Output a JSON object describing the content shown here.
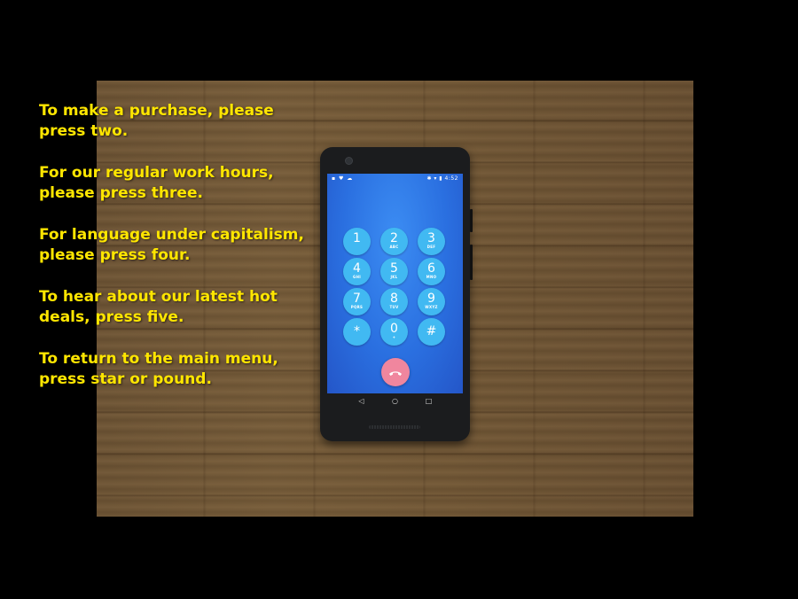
{
  "menu": {
    "lines": [
      "To make a purchase, please",
      "press two.",
      "For our regular work hours,",
      "please press three.",
      "For language under capitalism,",
      "please press four.",
      "To hear about our latest hot",
      "deals, press five.",
      "To return to the main menu,",
      "press star or pound."
    ],
    "text_color": "#ffe600"
  },
  "phone": {
    "status_left": "▪ ♥ ☁",
    "status_right": "✱ ▾ ▮ 4:52",
    "keypad": [
      {
        "digit": "1",
        "letters": ""
      },
      {
        "digit": "2",
        "letters": "ABC"
      },
      {
        "digit": "3",
        "letters": "DEF"
      },
      {
        "digit": "4",
        "letters": "GHI"
      },
      {
        "digit": "5",
        "letters": "JKL"
      },
      {
        "digit": "6",
        "letters": "MNO"
      },
      {
        "digit": "7",
        "letters": "PQRS"
      },
      {
        "digit": "8",
        "letters": "TUV"
      },
      {
        "digit": "9",
        "letters": "WXYZ"
      },
      {
        "digit": "*",
        "letters": ""
      },
      {
        "digit": "0",
        "letters": "+"
      },
      {
        "digit": "#",
        "letters": ""
      }
    ],
    "icons": {
      "end_call": "phone-hangup-icon",
      "back": "back-triangle-icon",
      "home": "home-circle-icon",
      "recents": "recents-square-icon"
    },
    "colors": {
      "key": "#41b9f2",
      "end_call": "#f0869e",
      "screen": "#2a6fe0"
    }
  }
}
